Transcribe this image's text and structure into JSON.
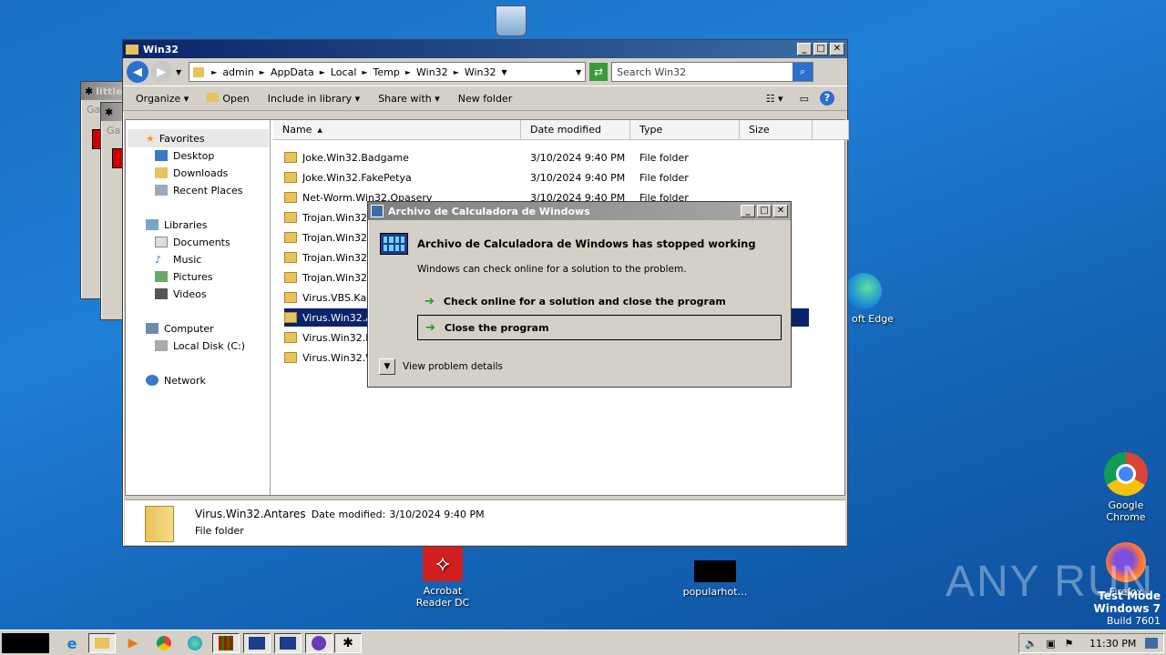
{
  "desktop": {
    "recycle_bin_label": "",
    "edge_label": "oft Edge",
    "chrome_label": "Google Chrome",
    "firefox_label": "Firefox",
    "acrobat_label": "Acrobat Reader DC",
    "popularhot_label": "popularhot…",
    "watermark": "ANY RUN",
    "test_mode": "Test Mode",
    "os_name": "Windows 7",
    "build": "Build 7601"
  },
  "background_windows": {
    "title_1": "little",
    "title_2": "",
    "label": "Ga"
  },
  "explorer": {
    "title": "Win32",
    "breadcrumb": [
      "admin",
      "AppData",
      "Local",
      "Temp",
      "Win32",
      "Win32"
    ],
    "search_placeholder": "Search Win32",
    "toolbar": {
      "organize": "Organize",
      "open": "Open",
      "include": "Include in library",
      "share": "Share with",
      "new_folder": "New folder"
    },
    "nav": {
      "favorites": "Favorites",
      "desktop": "Desktop",
      "downloads": "Downloads",
      "recent": "Recent Places",
      "libraries": "Libraries",
      "documents": "Documents",
      "music": "Music",
      "pictures": "Pictures",
      "videos": "Videos",
      "computer": "Computer",
      "local_disk": "Local Disk (C:)",
      "network": "Network"
    },
    "columns": {
      "name": "Name",
      "date": "Date modified",
      "type": "Type",
      "size": "Size"
    },
    "files": [
      {
        "name": "Joke.Win32.Badgame",
        "date": "3/10/2024 9:40 PM",
        "type": "File folder"
      },
      {
        "name": "Joke.Win32.FakePetya",
        "date": "3/10/2024 9:40 PM",
        "type": "File folder"
      },
      {
        "name": "Net-Worm.Win32.Opaserv",
        "date": "3/10/2024 9:40 PM",
        "type": "File folder"
      },
      {
        "name": "Trojan.Win32.",
        "date": "",
        "type": ""
      },
      {
        "name": "Trojan.Win32.",
        "date": "",
        "type": ""
      },
      {
        "name": "Trojan.Win32.",
        "date": "",
        "type": ""
      },
      {
        "name": "Trojan.Win32.",
        "date": "",
        "type": ""
      },
      {
        "name": "Virus.VBS.Karn",
        "date": "",
        "type": ""
      },
      {
        "name": "Virus.Win32.An",
        "date": "",
        "type": ""
      },
      {
        "name": "Virus.Win32.Ri",
        "date": "",
        "type": ""
      },
      {
        "name": "Virus.Win32.W",
        "date": "",
        "type": ""
      }
    ],
    "details": {
      "name": "Virus.Win32.Antares",
      "date_label": "Date modified:",
      "date_value": "3/10/2024 9:40 PM",
      "type": "File folder"
    }
  },
  "dialog": {
    "title": "Archivo de Calculadora de Windows",
    "heading": "Archivo de Calculadora de Windows has stopped working",
    "message": "Windows can check online for a solution to the problem.",
    "option_check": "Check online for a solution and close the program",
    "option_close": "Close the program",
    "details_label": "View problem details"
  },
  "taskbar": {
    "clock": "11:30 PM"
  },
  "colors": {
    "desktop": "#1a6fc4",
    "titlebar_active": "#0a246a",
    "selection": "#0a246a",
    "green_arrow": "#1a9d1a"
  }
}
